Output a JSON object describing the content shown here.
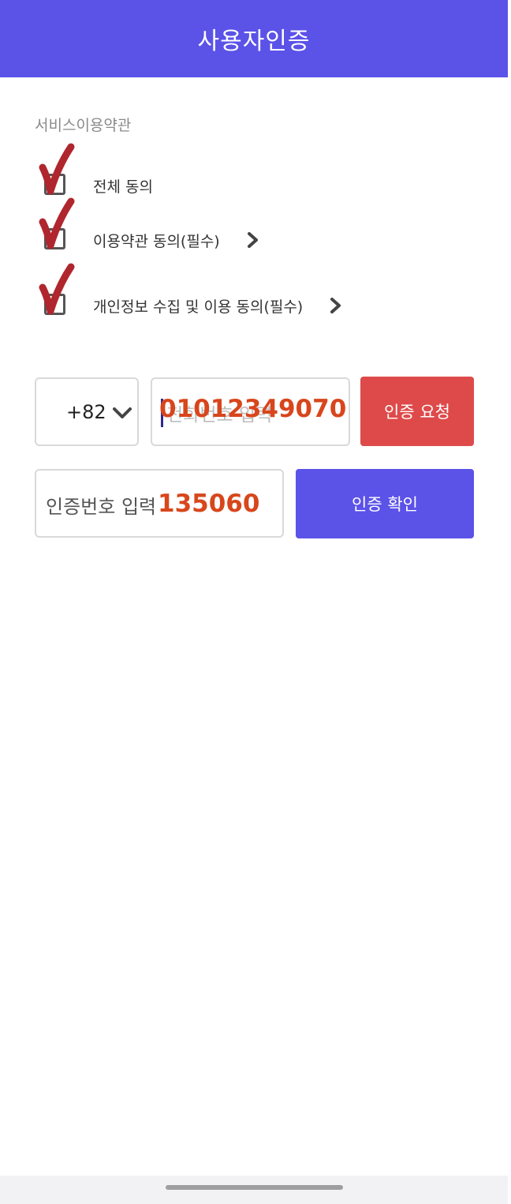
{
  "header": {
    "title": "사용자인증"
  },
  "terms": {
    "section_title": "서비스이용약관",
    "items": [
      {
        "label": "전체 동의",
        "checked": true,
        "has_detail": false
      },
      {
        "label": "이용약관 동의(필수)",
        "checked": true,
        "has_detail": true
      },
      {
        "label": "개인정보 수집 및 이용 동의(필수)",
        "checked": true,
        "has_detail": true
      }
    ]
  },
  "phone": {
    "country_code": "+82",
    "placeholder": "전화번호 입력",
    "overlay_value": "01012349070"
  },
  "request_button": {
    "label": "인증 요청"
  },
  "verification": {
    "placeholder": "인증번호 입력",
    "overlay_value": "135060"
  },
  "confirm_button": {
    "label": "인증 확인"
  },
  "colors": {
    "primary": "#5b52e8",
    "request": "#de4a4a",
    "overlay_text": "#d8461c",
    "hand_check": "#b0262e"
  }
}
